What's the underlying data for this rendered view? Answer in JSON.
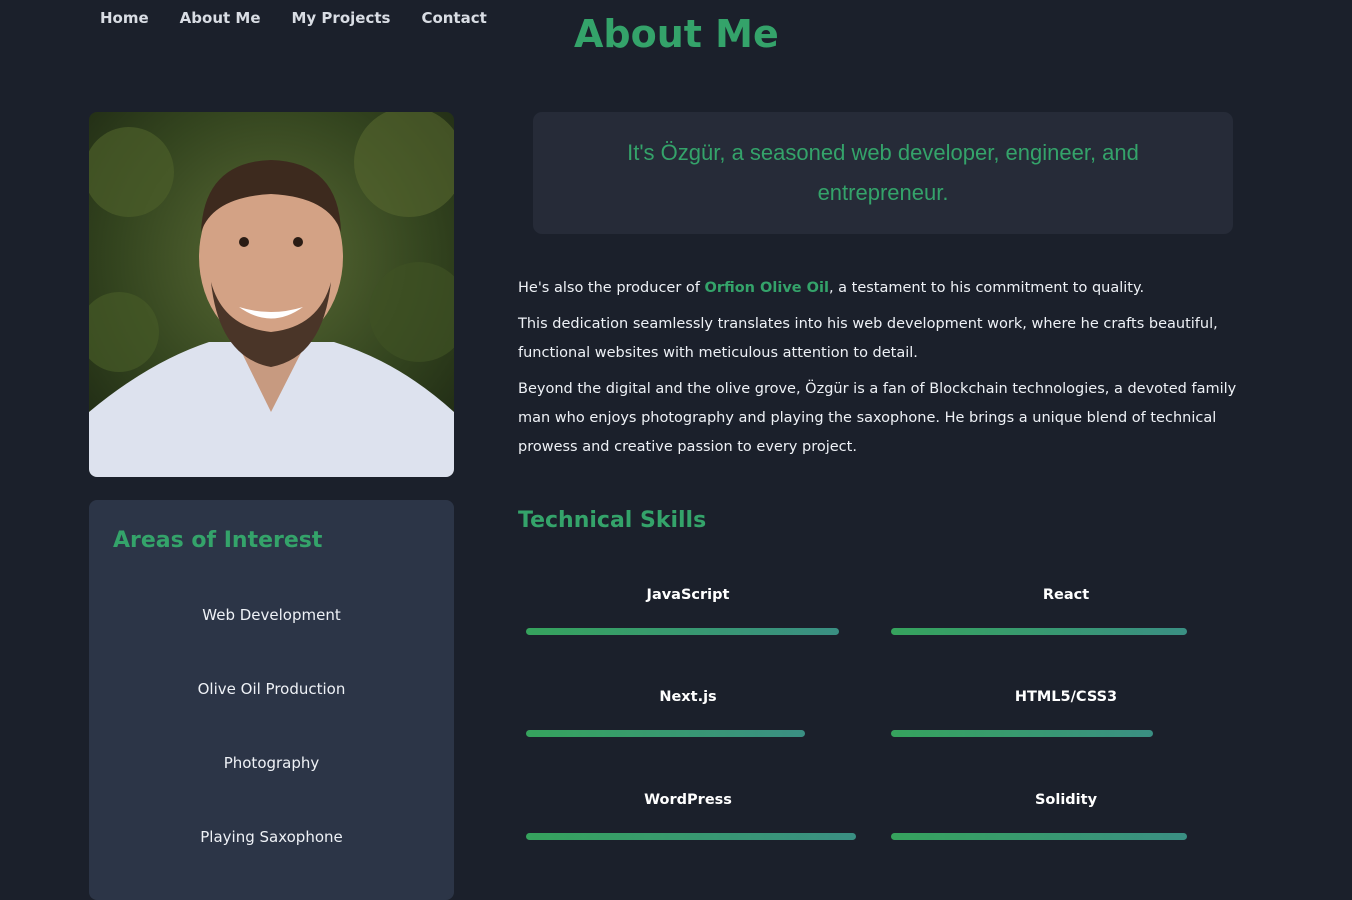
{
  "nav": {
    "items": [
      "Home",
      "About Me",
      "My Projects",
      "Contact"
    ]
  },
  "page": {
    "title": "About Me"
  },
  "intro": {
    "text": "It's Özgür, a seasoned web developer, engineer, and entrepreneur."
  },
  "bio": {
    "p1_before": "He's also the producer of ",
    "p1_brand": "Orfion Olive Oil",
    "p1_after": ", a testament to his commitment to quality.",
    "p2": "This dedication seamlessly translates into his web development work, where he crafts beautiful, functional websites with meticulous attention to detail.",
    "p3": "Beyond the digital and the olive grove, Özgür is a fan of Blockchain technologies, a devoted family man who enjoys photography and playing the saxophone. He brings a unique blend of technical prowess and creative passion to every project."
  },
  "interests": {
    "title": "Areas of Interest",
    "items": [
      "Web Development",
      "Olive Oil Production",
      "Photography",
      "Playing Saxophone"
    ]
  },
  "skills": {
    "title": "Technical Skills",
    "items": [
      {
        "name": "JavaScript",
        "level": 0.92
      },
      {
        "name": "React",
        "level": 0.87
      },
      {
        "name": "Next.js",
        "level": 0.82
      },
      {
        "name": "HTML5/CSS3",
        "level": 0.77
      },
      {
        "name": "WordPress",
        "level": 0.97
      },
      {
        "name": "Solidity",
        "level": 0.87
      }
    ]
  },
  "colors": {
    "accent": "#34a36a",
    "background": "#1b202b",
    "card": "#2c3547",
    "intro_card": "#262b38"
  }
}
